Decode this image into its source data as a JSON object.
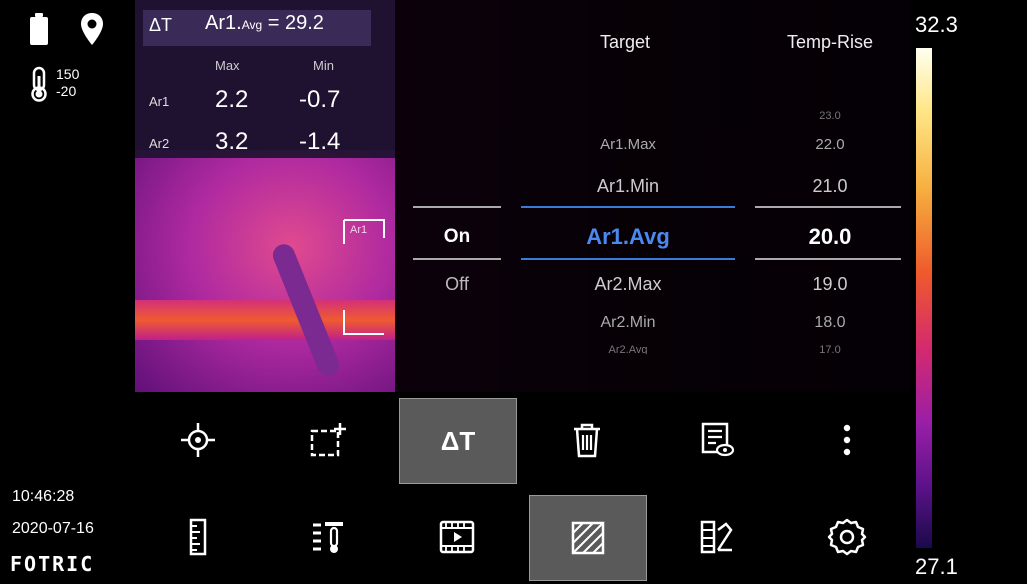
{
  "status": {
    "range_high": "150",
    "range_low": "-20",
    "time": "10:46:28",
    "date": "2020-07-16",
    "brand": "FOTRIC"
  },
  "measurement": {
    "delta_symbol": "ΔT",
    "title_label": "Ar1.Avg",
    "title_prefix": "Ar1.",
    "title_sub": "Avg",
    "title_value": "= 29.2",
    "col_max": "Max",
    "col_min": "Min",
    "rows": [
      {
        "label": "Ar1",
        "max": "2.2",
        "min": "-0.7"
      },
      {
        "label": "Ar2",
        "max": "3.2",
        "min": "-1.4"
      }
    ],
    "roi_label": "Ar1"
  },
  "picker": {
    "header_target": "Target",
    "header_rise": "Temp-Rise",
    "switch_options": [
      {
        "label": "On",
        "selected": true
      },
      {
        "label": "Off",
        "selected": false
      }
    ],
    "targets": [
      "Ar1.Max",
      "Ar1.Min",
      "Ar1.Avg",
      "Ar2.Max",
      "Ar2.Min",
      "Ar2.Avg"
    ],
    "target_selected": "Ar1.Avg",
    "rises": [
      "23.0",
      "22.0",
      "21.0",
      "20.0",
      "19.0",
      "18.0",
      "17.0"
    ],
    "rise_selected": "20.0",
    "accent_color": "#3a7ad8"
  },
  "toolbar_tools": [
    {
      "name": "spot-tool",
      "icon": "crosshair-icon",
      "active": false
    },
    {
      "name": "area-tool",
      "icon": "add-rectangle-icon",
      "active": false
    },
    {
      "name": "delta-t-tool",
      "icon": "delta-t-icon",
      "active": true,
      "label": "ΔT"
    },
    {
      "name": "delete-tool",
      "icon": "trash-icon",
      "active": false
    },
    {
      "name": "view-list-tool",
      "icon": "list-eye-icon",
      "active": false
    },
    {
      "name": "more-tool",
      "icon": "more-vertical-icon",
      "active": false
    }
  ],
  "toolbar_main": [
    {
      "name": "ruler-tool",
      "icon": "ruler-icon",
      "active": false
    },
    {
      "name": "level-span-tool",
      "icon": "thermo-list-icon",
      "active": false
    },
    {
      "name": "media-tool",
      "icon": "video-icon",
      "active": false
    },
    {
      "name": "analysis-tool",
      "icon": "hatched-rectangle-icon",
      "active": true
    },
    {
      "name": "palette-tool",
      "icon": "palette-icon",
      "active": false
    },
    {
      "name": "settings-tool",
      "icon": "gear-icon",
      "active": false
    }
  ],
  "scale": {
    "max": "32.3",
    "min": "27.1"
  }
}
